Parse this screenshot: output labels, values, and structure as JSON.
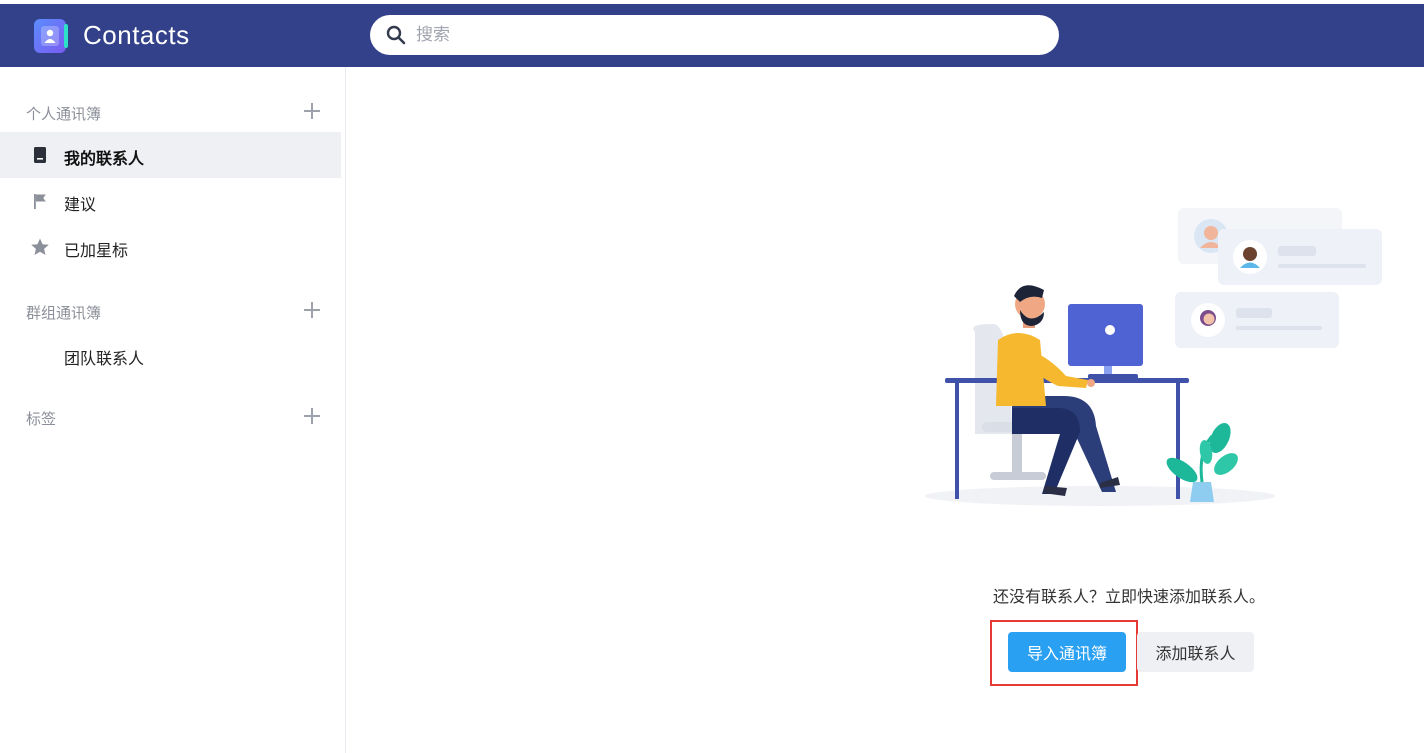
{
  "app": {
    "title": "Contacts"
  },
  "search": {
    "placeholder": "搜索",
    "value": ""
  },
  "sidebar": {
    "personal_section": {
      "label": "个人通讯簿"
    },
    "personal_items": [
      {
        "label": "我的联系人",
        "icon": "address-book-icon",
        "active": true
      },
      {
        "label": "建议",
        "icon": "flag-icon",
        "active": false
      },
      {
        "label": "已加星标",
        "icon": "star-icon",
        "active": false
      }
    ],
    "group_section": {
      "label": "群组通讯簿"
    },
    "group_items": [
      {
        "label": "团队联系人"
      }
    ],
    "tags_section": {
      "label": "标签"
    }
  },
  "main": {
    "empty_message": "还没有联系人？立即快速添加联系人。",
    "import_button": "导入通讯簿",
    "add_button": "添加联系人"
  },
  "colors": {
    "header_bg": "#33408a",
    "primary_button": "#2aa0f2",
    "active_item_bg": "#eef0f4",
    "highlight_border": "#e53935"
  }
}
